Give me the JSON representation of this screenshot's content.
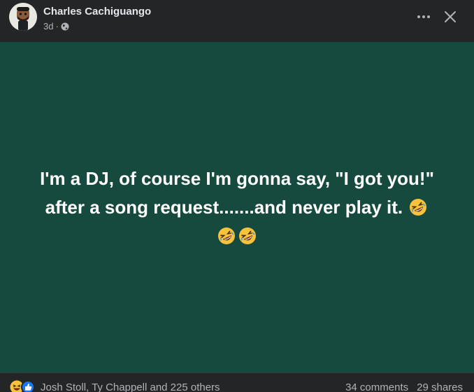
{
  "post": {
    "author": "Charles Cachiguango",
    "time": "3d",
    "separator": "·",
    "privacy_icon": "globe-icon",
    "text_line1": "I'm a DJ, of course I'm gonna say, \"I got you!\"",
    "text_line2": "after a song request.......and never play it.",
    "emoji": "rolling-on-floor-laughing",
    "background_color": "#174a3f"
  },
  "footer": {
    "reaction_icons": [
      "laughing-icon",
      "like-icon"
    ],
    "reactions_text": "Josh Stoll, Ty Chappell and 225 others",
    "comments": "34 comments",
    "shares": "29 shares"
  },
  "colors": {
    "surface": "#242526",
    "text_primary": "#e4e6eb",
    "text_secondary": "#b0b3b8",
    "like_blue": "#1877f2"
  }
}
